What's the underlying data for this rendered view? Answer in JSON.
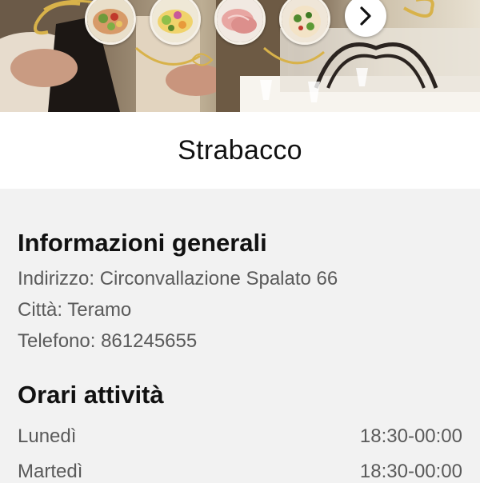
{
  "restaurant": {
    "name": "Strabacco"
  },
  "carousel": {
    "photos": [
      {
        "icon": "food-photo-salad"
      },
      {
        "icon": "food-photo-vegetables"
      },
      {
        "icon": "food-photo-ham"
      },
      {
        "icon": "food-photo-pizza"
      }
    ],
    "next_icon": "chevron-right-icon"
  },
  "general_info": {
    "heading": "Informazioni generali",
    "address": "Indirizzo: Circonvallazione Spalato 66",
    "city": "Città: Teramo",
    "phone": "Telefono: 861245655"
  },
  "hours": {
    "heading": "Orari attività",
    "days": [
      {
        "day": "Lunedì",
        "time": "18:30-00:00"
      },
      {
        "day": "Martedì",
        "time": "18:30-00:00"
      }
    ]
  },
  "colors": {
    "title_bar": "#ffffff",
    "content_bg": "#f2f2f2",
    "heading_text": "#111111",
    "body_text": "#5a5a5a"
  }
}
